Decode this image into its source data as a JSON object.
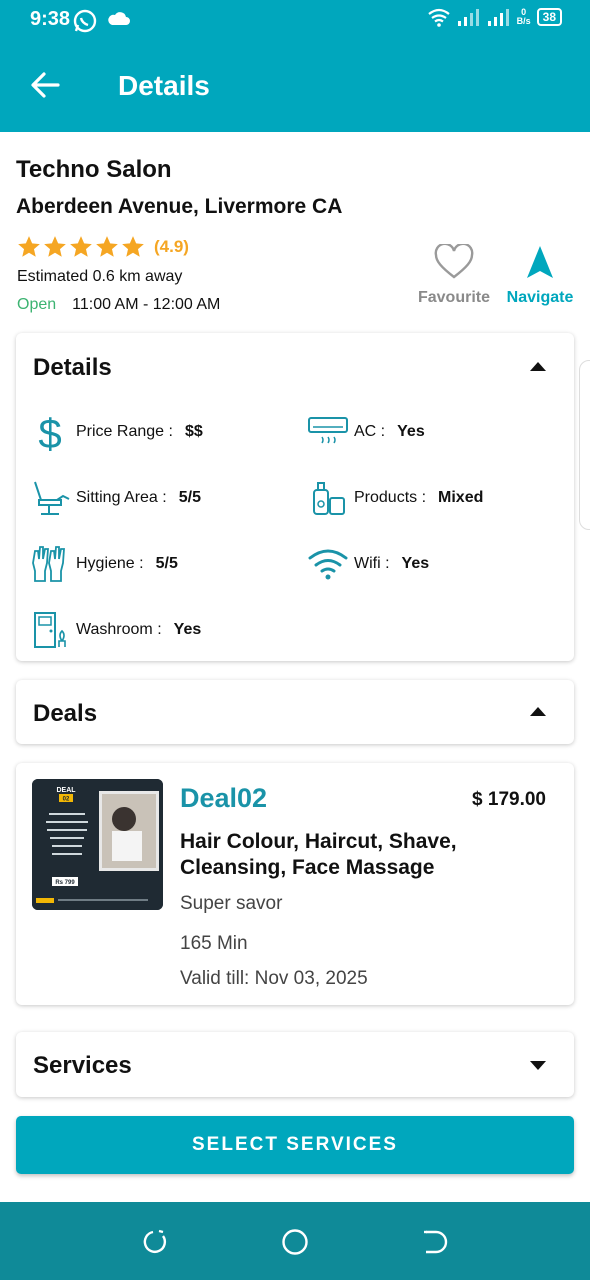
{
  "status_bar": {
    "time": "9:38",
    "battery": "38",
    "net_speed_value": "0",
    "net_speed_unit": "B/s"
  },
  "appbar": {
    "title": "Details"
  },
  "salon": {
    "name": "Techno Salon",
    "address": "Aberdeen Avenue, Livermore CA",
    "rating": "(4.9)",
    "stars": 5,
    "distance": "Estimated 0.6 km away",
    "status": "Open",
    "hours": "11:00 AM - 12:00 AM"
  },
  "actions": {
    "favourite": "Favourite",
    "navigate": "Navigate"
  },
  "details": {
    "title": "Details",
    "items": [
      {
        "icon": "dollar-icon",
        "label": "Price Range :",
        "value": "$$"
      },
      {
        "icon": "ac-icon",
        "label": "AC :",
        "value": "Yes"
      },
      {
        "icon": "salon-chair-icon",
        "label": "Sitting Area :",
        "value": "5/5"
      },
      {
        "icon": "products-icon",
        "label": "Products :",
        "value": "Mixed"
      },
      {
        "icon": "gloves-icon",
        "label": "Hygiene :",
        "value": "5/5"
      },
      {
        "icon": "wifi-icon",
        "label": "Wifi :",
        "value": "Yes"
      },
      {
        "icon": "washroom-icon",
        "label": "Washroom :",
        "value": "Yes"
      }
    ]
  },
  "deals": {
    "title": "Deals",
    "items": [
      {
        "name": "Deal02",
        "price": "$ 179.00",
        "description": "Hair Colour, Haircut, Shave, Cleansing, Face Massage",
        "type": "Super savor",
        "duration": "165 Min",
        "valid": "Valid till: Nov 03, 2025",
        "image": {
          "heading": "DEAL",
          "number": "02",
          "price_tag": "Rs 799"
        }
      }
    ]
  },
  "services": {
    "title": "Services"
  },
  "select_button": {
    "label": "SELECT SERVICES"
  },
  "colors": {
    "primary": "#00a7bd",
    "star": "#f5a623",
    "open": "#3cb371",
    "deal_name": "#1a93a8",
    "navbar": "#0f8a98"
  }
}
